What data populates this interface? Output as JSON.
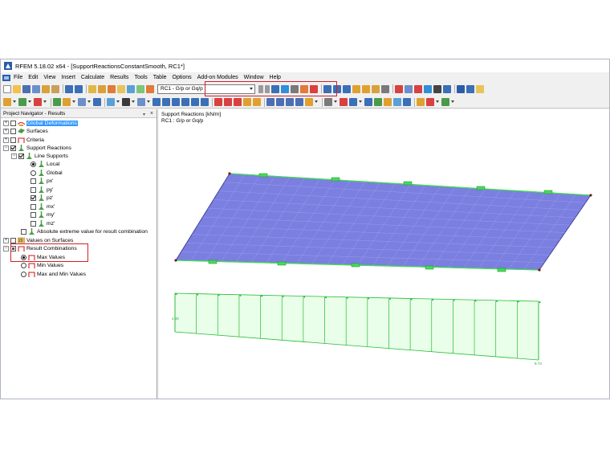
{
  "window": {
    "title": "RFEM 5.18.02 x64 - [SupportReactionsConstantSmooth, RC1*]"
  },
  "menu": [
    "File",
    "Edit",
    "View",
    "Insert",
    "Calculate",
    "Results",
    "Tools",
    "Table",
    "Options",
    "Add-on Modules",
    "Window",
    "Help"
  ],
  "toolbar": {
    "load_case": "RC1 - G/p or Gq/p"
  },
  "navigator": {
    "title": "Project Navigator - Results",
    "items": {
      "global_deformations": "Global Deformations",
      "surfaces": "Surfaces",
      "criteria": "Criteria",
      "support_reactions": "Support Reactions",
      "line_supports": "Line Supports",
      "local": "Local",
      "global": "Global",
      "px": "px'",
      "py": "py'",
      "pz": "pz'",
      "mx": "mx'",
      "my": "my'",
      "mz": "mz'",
      "absolute_extreme": "Absolute extreme value for result combination",
      "values_on_surfaces": "Values on Surfaces",
      "result_combinations": "Result Combinations",
      "max_values": "Max Values",
      "min_values": "Min Values",
      "max_min_values": "Max and Min Values"
    }
  },
  "viewport": {
    "heading": "Support Reactions [kN/m]",
    "subheading": "RC1 : G/p or Gq/p",
    "diagram_start_label": "4.00",
    "diagram_end_label": "9.73"
  },
  "colors": {
    "surface_fill": "#7b7fe0",
    "support_green": "#44dd55",
    "diagram_fill": "#eaffea",
    "highlight_red": "#d2202a",
    "selection_blue": "#3399ff"
  }
}
